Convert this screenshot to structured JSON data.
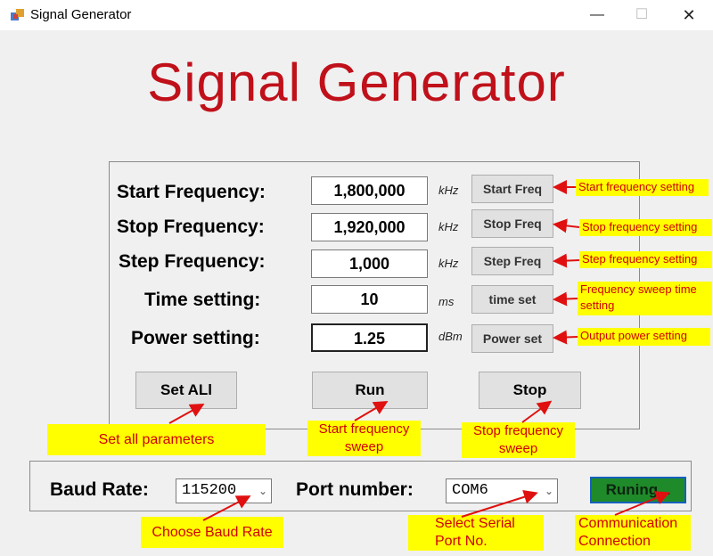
{
  "window": {
    "title": "Signal Generator",
    "min_glyph": "—",
    "max_glyph": "☐",
    "close_glyph": "✕"
  },
  "header": {
    "title": "Signal Generator"
  },
  "settings": [
    {
      "label": "Start Frequency:",
      "value": "1,800,000",
      "unit": "kHz",
      "button": "Start Freq",
      "note": "Start frequency setting"
    },
    {
      "label": "Stop Frequency:",
      "value": "1,920,000",
      "unit": "kHz",
      "button": "Stop Freq",
      "note": "Stop frequency setting"
    },
    {
      "label": "Step Frequency:",
      "value": "1,000",
      "unit": "kHz",
      "button": "Step Freq",
      "note": "Step frequency setting"
    },
    {
      "label": "Time setting:",
      "value": "10",
      "unit": "ms",
      "button": "time set",
      "note": "Frequency sweep time setting"
    },
    {
      "label": "Power setting:",
      "value": "1.25",
      "unit": "dBm",
      "button": "Power set",
      "note": "Output power setting"
    }
  ],
  "actions": {
    "set_all": "Set ALl",
    "run": "Run",
    "stop": "Stop",
    "set_all_note": "Set all parameters",
    "run_note": "Start frequency sweep",
    "stop_note": "Stop frequency sweep"
  },
  "connection": {
    "baud_label": "Baud Rate:",
    "baud_value": "115200",
    "port_label": "Port number:",
    "port_value": "COM6",
    "status": "Runing...",
    "baud_note": "Choose Baud Rate",
    "port_note": "Select Serial Port No.",
    "status_note": "Communication Connection"
  },
  "colors": {
    "title_red": "#c0101a",
    "note_bg": "#ffff00",
    "note_text": "#d00000",
    "status_green": "#1f8a2a"
  }
}
